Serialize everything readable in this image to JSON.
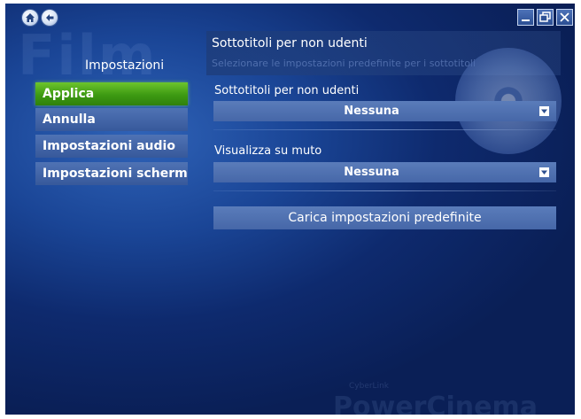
{
  "watermark": {
    "section_text": "Film",
    "brand_small": "CyberLink",
    "brand": "PowerCinema"
  },
  "window_controls": {
    "minimize_icon": "minimize-icon",
    "maximize_icon": "restore-icon",
    "close_icon": "close-icon"
  },
  "nav": {
    "home_icon": "home-icon",
    "back_icon": "back-arrow-icon"
  },
  "menu": {
    "title": "Impostazioni",
    "items": [
      {
        "label": "Applica",
        "active": true
      },
      {
        "label": "Annulla",
        "active": false
      },
      {
        "label": "Impostazioni audio",
        "active": false
      },
      {
        "label": "Impostazioni schermo",
        "active": false
      }
    ]
  },
  "panel": {
    "title": "Sottotitoli per non udenti",
    "description": "Selezionare le impostazioni predefinite per i sottotitoli"
  },
  "fields": [
    {
      "label": "Sottotitoli per non udenti",
      "value": "Nessuna"
    },
    {
      "label": "Visualizza su muto",
      "value": "Nessuna"
    }
  ],
  "defaults_button": "Carica impostazioni predefinite",
  "colors": {
    "active_item": "#3d9a12",
    "background": "#1a4596",
    "control": "#4f73b4"
  }
}
